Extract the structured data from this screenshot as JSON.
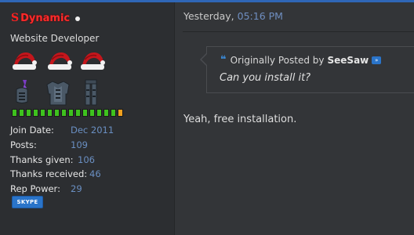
{
  "user": {
    "logo_glyph": "S",
    "username": "Dynamic",
    "title": "Website Developer",
    "hats": [
      "santa-hat-icon",
      "santa-hat-icon",
      "santa-hat-icon"
    ],
    "armor": [
      "helmet-icon",
      "platebody-icon",
      "platelegs-icon"
    ],
    "reputation_segments": 10,
    "colors": {
      "username": "#ff2a2a",
      "rep_green": "#3ec21e",
      "rep_orange": "#f0a01e",
      "link_blue": "#6a8fc2"
    },
    "stats": [
      {
        "label": "Join Date:",
        "value": "Dec 2011"
      },
      {
        "label": "Posts:",
        "value": "109"
      },
      {
        "label": "Thanks given:",
        "value": "106"
      },
      {
        "label": "Thanks received:",
        "value": "46"
      },
      {
        "label": "Rep Power:",
        "value": "29"
      }
    ],
    "skype_label": "SKYPE"
  },
  "post": {
    "date": "Yesterday,",
    "time": "05:16 PM",
    "quote": {
      "prefix": "Originally Posted by",
      "author": "SeeSaw",
      "text": "Can you install it?"
    },
    "message": "Yeah, free installation."
  }
}
